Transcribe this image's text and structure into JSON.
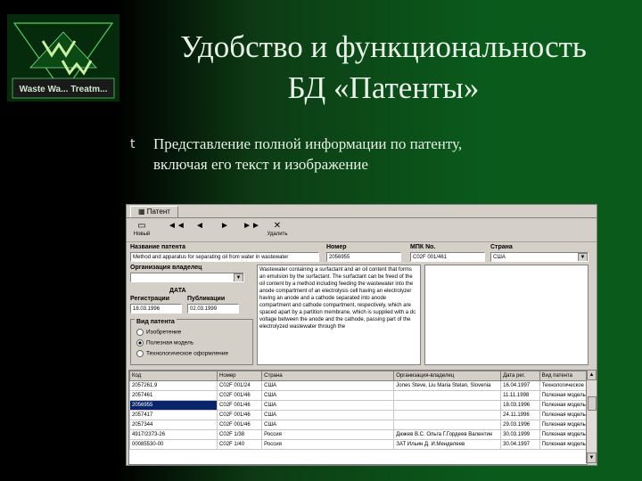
{
  "slide": {
    "logo_text": "Waste Wa... Treatm...",
    "title_line1": "Удобство и функциональность",
    "title_line2": "БД «Патенты»",
    "bullet_glyph": "t",
    "bullet_text_line1": "Представление полной информации по патенту,",
    "bullet_text_line2": "включая его текст и изображение"
  },
  "app": {
    "tab": "Патент",
    "toolbar": {
      "new_label": "Новый",
      "first": "◄◄",
      "prev": "◄",
      "next": "►",
      "last": "►►",
      "delete_label": "Удалить",
      "delete_icon": "✕"
    },
    "labels": {
      "title": "Название патента",
      "number": "Номер",
      "ipc": "МПК No.",
      "country": "Страна",
      "org": "Организация владелец",
      "date": "ДАТА",
      "reg": "Регистрации",
      "pub": "Публикации",
      "type": "Вид патента"
    },
    "values": {
      "title": "Method and apparatus for separating oil from water in wastewater",
      "number": "2056955",
      "ipc": "C02F 001/461",
      "country": "США",
      "org": "",
      "reg_date": "18.03.1996",
      "pub_date": "02.03.1999"
    },
    "abstract": "Wastewater containing a surfactant and an oil content that forms an emulsion by the surfactant. The surfactant can be freed of the oil content by a method including feeding the wastewater into the anode compartment of an electrolysis cell having an electrolyzer having an anode and a cathode separated into anode compartment and cathode compartment, respectively, which are spaced apart by a partition membrane, which is supplied with a dc voltage between the anode and the cathode, passing part of the electrolyzed wastewater through the",
    "patent_types": [
      {
        "label": "Изобретение",
        "checked": false
      },
      {
        "label": "Полезная модель",
        "checked": true
      },
      {
        "label": "Технологическое оформление",
        "checked": false
      }
    ],
    "grid": {
      "columns": [
        "Код",
        "Номер",
        "Страна",
        "Организация-владелец",
        "Дата рег.",
        "Вид патента"
      ],
      "rows": [
        [
          "2057261.9",
          "C02F 001/24",
          "США",
          "Jones Steve, Liu Maria Stelan, Slovenia",
          "16.04.1997",
          "Технологическое офор"
        ],
        [
          "2057461",
          "C02F 001/46",
          "США",
          "",
          "11.11.1998",
          "Полезная модель"
        ],
        [
          "2056955",
          "C02F 001/46",
          "США",
          "",
          "18.03.1996",
          "Полезная модель"
        ],
        [
          "2057417",
          "C02F 001/46",
          "США",
          "",
          "24.11.1996",
          "Полезная модель"
        ],
        [
          "2057344",
          "C02F 001/46",
          "США",
          "",
          "29.03.1996",
          "Полезная модель"
        ],
        [
          "4917/2373-26",
          "C02F 1/38",
          "Россия",
          "Дюжев В.С. Ольга Г.Гордеев Валентин",
          "30.03.1999",
          "Полезная модель"
        ],
        [
          "00085530-00",
          "C02F 1/40",
          "Россия",
          "ЗАТ Ильин Д. И.Менделеев",
          "30.04.1997",
          "Полезная модель"
        ]
      ],
      "selected_row": 2
    }
  }
}
